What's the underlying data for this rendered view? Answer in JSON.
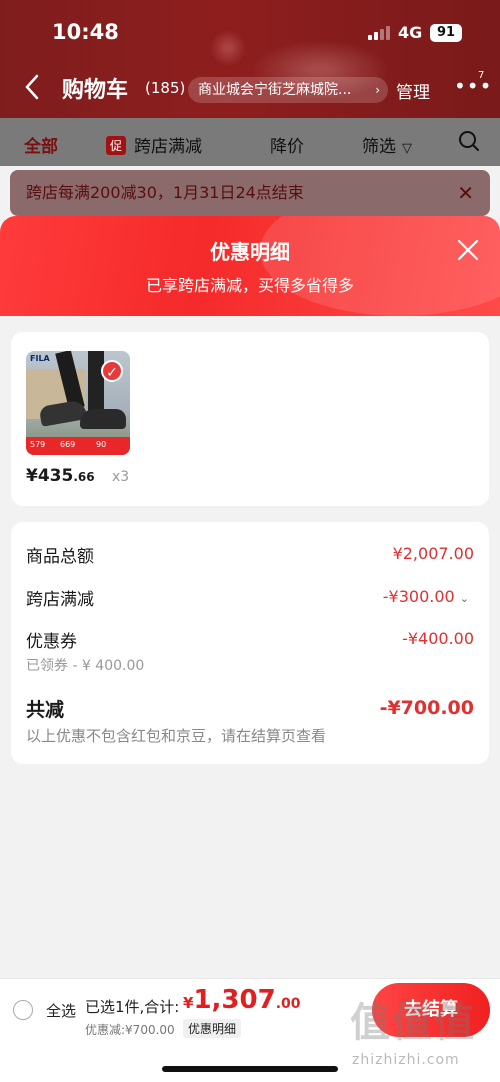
{
  "status_bar": {
    "time": "10:48",
    "network": "4G",
    "battery": "91"
  },
  "cart_header": {
    "title": "购物车",
    "count": "(185)",
    "address": "商业城会宁街芝麻城院...",
    "manage": "管理",
    "more_badge": "7"
  },
  "tabs": {
    "all": "全部",
    "promo_tag": "促",
    "cross_store": "跨店满减",
    "price_drop": "降价",
    "filter": "筛选"
  },
  "notice": {
    "text": "跨店每满200减30，1月31日24点结束"
  },
  "sheet": {
    "title": "优惠明细",
    "subtitle": "已享跨店满减，买得多省得多"
  },
  "product": {
    "brand": "FILA",
    "price_int": "¥435",
    "price_dec": ".66",
    "quantity": "x3",
    "band_prices": [
      "579",
      "669",
      "90"
    ]
  },
  "summary": {
    "goods_total_label": "商品总额",
    "goods_total_value": "¥2,007.00",
    "cross_store_label": "跨店满减",
    "cross_store_value": "-¥300.00",
    "coupon_label": "优惠券",
    "coupon_value": "-¥400.00",
    "coupon_sub": "已领券 - ¥ 400.00",
    "total_label": "共减",
    "total_value": "-¥700.00",
    "total_note": "以上优惠不包含红包和京豆，请在结算页查看"
  },
  "bottom_bar": {
    "select_all": "全选",
    "selected_info": "已选1件,合计:",
    "yen": "¥",
    "amount_int": "1,307",
    "amount_dec": ".00",
    "discount_note": "优惠减:¥700.00",
    "detail_button": "优惠明细",
    "checkout": "去结算"
  },
  "watermark": {
    "text": "值值值",
    "url": "zhizhizhi.com"
  },
  "colors": {
    "brand_red": "#e03030",
    "header_dark_red": "#7f1d1d"
  }
}
